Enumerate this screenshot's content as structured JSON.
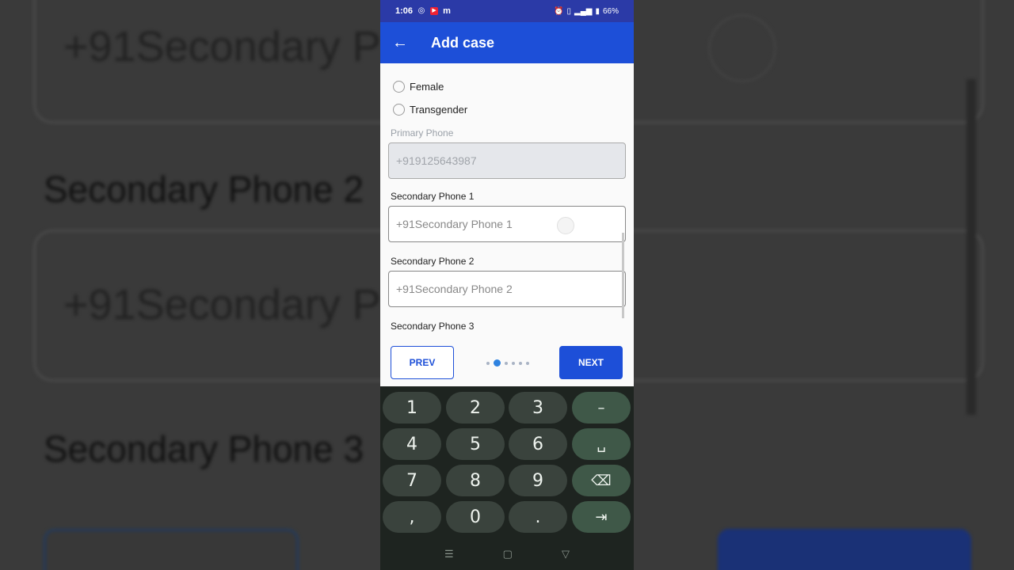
{
  "background": {
    "placeholder_top": "+91Secondary P",
    "label_mid": "Secondary Phone 2",
    "placeholder_mid": "+91Secondary P",
    "label_bottom": "Secondary Phone 3"
  },
  "status_bar": {
    "time": "1:06",
    "app_m": "m",
    "battery": "66%"
  },
  "app_bar": {
    "title": "Add case",
    "back_icon": "arrow-back-icon"
  },
  "form": {
    "radios": [
      {
        "label": "Female",
        "selected": false
      },
      {
        "label": "Transgender",
        "selected": false
      }
    ],
    "primary_phone": {
      "label": "Primary Phone",
      "prefix": "+91",
      "value": "9125643987"
    },
    "secondary_1": {
      "label": "Secondary Phone 1",
      "prefix": "+91",
      "placeholder": "Secondary Phone 1"
    },
    "secondary_2": {
      "label": "Secondary Phone 2",
      "prefix": "+91",
      "placeholder": "Secondary Phone 2"
    },
    "secondary_3": {
      "label": "Secondary Phone 3"
    }
  },
  "nav": {
    "prev": "PREV",
    "next": "NEXT",
    "step_count": 6,
    "active_step": 1
  },
  "keyboard": {
    "rows": [
      [
        "1",
        "2",
        "3",
        "–"
      ],
      [
        "4",
        "5",
        "6",
        "␣"
      ],
      [
        "7",
        "8",
        "9",
        "⌫"
      ],
      [
        ",",
        "0",
        ".",
        "⇥"
      ]
    ]
  },
  "system_nav": {
    "recents": "☰",
    "home": "▢",
    "back": "▽"
  },
  "colors": {
    "primary": "#1d4fd8",
    "status_bar": "#2b3aa7",
    "keyboard_bg": "#1e2420"
  }
}
